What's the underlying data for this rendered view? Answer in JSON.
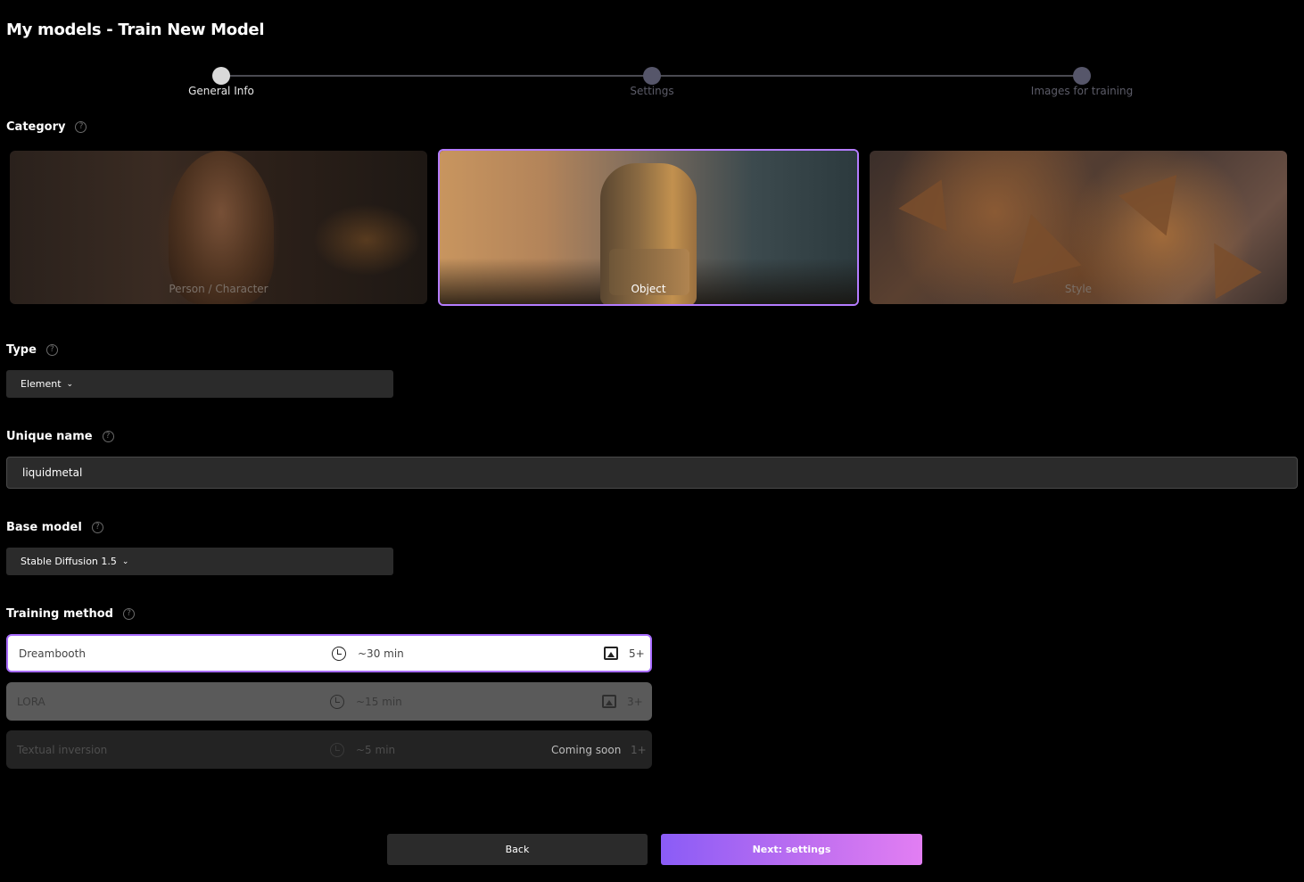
{
  "page": {
    "title": "My models - Train New Model"
  },
  "stepper": {
    "steps": [
      {
        "label": "General Info",
        "active": true
      },
      {
        "label": "Settings",
        "active": false
      },
      {
        "label": "Images for training",
        "active": false
      }
    ]
  },
  "category": {
    "label": "Category",
    "help": "?",
    "options": [
      {
        "label": "Person / Character",
        "selected": false
      },
      {
        "label": "Object",
        "selected": true
      },
      {
        "label": "Style",
        "selected": false
      }
    ]
  },
  "type": {
    "label": "Type",
    "help": "?",
    "value": "Element"
  },
  "unique_name": {
    "label": "Unique name",
    "help": "?",
    "value": "liquidmetal"
  },
  "base_model": {
    "label": "Base model",
    "help": "?",
    "value": "Stable Diffusion 1.5"
  },
  "training_method": {
    "label": "Training method",
    "help": "?",
    "options": [
      {
        "name": "Dreambooth",
        "time": "~30 min",
        "images": "5+",
        "selected": true
      },
      {
        "name": "LORA",
        "time": "~15 min",
        "images": "3+",
        "selected": false
      },
      {
        "name": "Textual inversion",
        "time": "~5 min",
        "status": "Coming soon",
        "images": "1+",
        "selected": false
      }
    ]
  },
  "footer": {
    "back_label": "Back",
    "next_label": "Next: settings"
  },
  "colors": {
    "accent": "#a86cff",
    "button_gradient_start": "#8a5cf6",
    "button_gradient_end": "#e27ef3",
    "background": "#000000"
  }
}
